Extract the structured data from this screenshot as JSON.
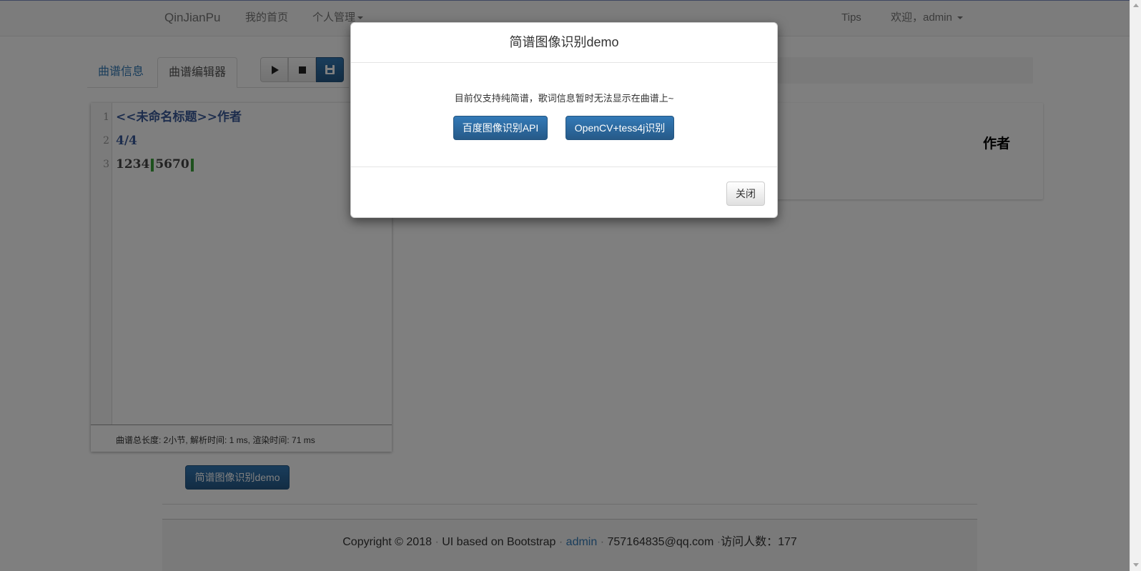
{
  "navbar": {
    "brand": "QinJianPu",
    "home": "我的首页",
    "personal_manage": "个人管理",
    "tips": "Tips",
    "welcome": "欢迎，admin"
  },
  "tabs": [
    {
      "label": "曲谱信息",
      "active": false
    },
    {
      "label": "曲谱编辑器",
      "active": true
    }
  ],
  "toolbar": {
    "icons": [
      "play-icon",
      "stop-icon",
      "save-icon"
    ]
  },
  "editor": {
    "lines": [
      {
        "number": "1",
        "text": "<<未命名标题>>作者"
      },
      {
        "number": "2",
        "text": "4/4"
      },
      {
        "number": "3",
        "measures": [
          "1234",
          "5670"
        ]
      }
    ],
    "status": "曲谱总长度: 2小节, 解析时间: 1 ms, 渲染时间: 71 ms"
  },
  "preview": {
    "author": "作者"
  },
  "demo_button": "简谱图像识别demo",
  "modal": {
    "title": "简谱图像识别demo",
    "note": "目前仅支持纯简谱，歌词信息暂时无法显示在曲谱上~",
    "baidu_button": "百度图像识别API",
    "opencv_button": "OpenCV+tess4j识别",
    "close_button": "关闭"
  },
  "footer": {
    "copyright": "Copyright © 2018",
    "ui_text": "UI based on Bootstrap",
    "admin_link": "admin",
    "email": "757164835@qq.com",
    "visitors": "访问人数：177"
  },
  "colors": {
    "primary": "#337ab7",
    "navbar_bg": "#f8f8f8",
    "bar_mark": "#3aa33a"
  }
}
